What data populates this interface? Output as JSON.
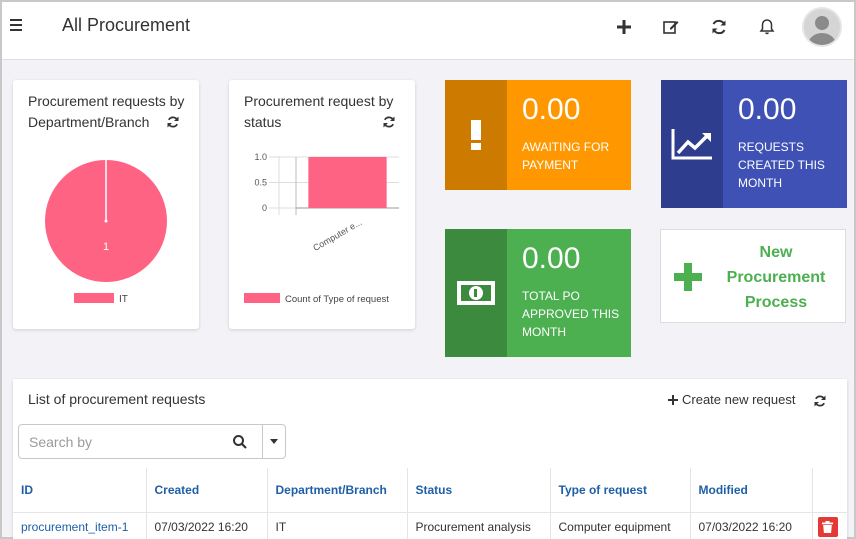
{
  "header": {
    "title": "All Procurement"
  },
  "colors": {
    "orange": "#ff9800",
    "orange_dark": "#cc7a00",
    "blue": "#3f51b5",
    "blue_dark": "#2f3d8f",
    "green": "#4caf50",
    "green_dark": "#3b8a3e",
    "pink": "#ff6384",
    "link": "#1e5fa8",
    "danger": "#e53935"
  },
  "cards": {
    "dept": {
      "title_line1": "Procurement requests by",
      "title_line2": "Department/Branch"
    },
    "status": {
      "title_line1": "Procurement request by",
      "title_line2": "status"
    }
  },
  "stats": {
    "awaiting": {
      "value": "0.00",
      "label_line1": "AWAITING FOR",
      "label_line2": "PAYMENT",
      "icon": "exclamation-icon"
    },
    "created": {
      "value": "0.00",
      "label_line1": "REQUESTS",
      "label_line2": "CREATED THIS",
      "label_line3": "MONTH",
      "icon": "trending-up-icon"
    },
    "approved": {
      "value": "0.00",
      "label_line1": "TOTAL PO",
      "label_line2": "APPROVED THIS",
      "label_line3": "MONTH",
      "icon": "money-icon"
    }
  },
  "new_process": {
    "line1": "New",
    "line2": "Procurement",
    "line3": "Process"
  },
  "list": {
    "title": "List of procurement requests",
    "create_label": "Create new request",
    "search_placeholder": "Search by",
    "columns": [
      "ID",
      "Created",
      "Department/Branch",
      "Status",
      "Type of request",
      "Modified"
    ],
    "rows": [
      {
        "id": "procurement_item-1",
        "created": "07/03/2022 16:20",
        "department": "IT",
        "status": "Procurement analysis",
        "type": "Computer equipment",
        "modified": "07/03/2022 16:20"
      }
    ]
  },
  "chart_data": [
    {
      "type": "pie",
      "categories": [
        "IT"
      ],
      "values": [
        1
      ],
      "data_labels": [
        "1"
      ],
      "legend": [
        "IT"
      ],
      "legend_position": "bottom",
      "colors": [
        "#ff6384"
      ]
    },
    {
      "type": "bar",
      "categories": [
        "Computer e..."
      ],
      "series": [
        {
          "name": "Count of Type of request",
          "values": [
            1
          ]
        }
      ],
      "yticks": [
        "0",
        "0.5",
        "1.0"
      ],
      "ylim": [
        0,
        1.0
      ],
      "grid": true,
      "legend_position": "bottom",
      "colors": [
        "#ff6384"
      ]
    }
  ]
}
